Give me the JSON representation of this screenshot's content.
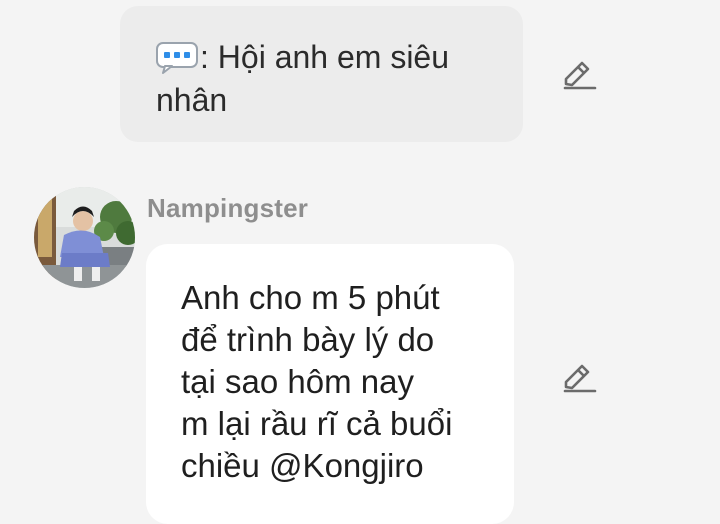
{
  "system_message": {
    "icon": "chat-bubble-dots-icon",
    "text": ": Hội anh em siêu nhân"
  },
  "message": {
    "sender": "Nampingster",
    "text": "Anh cho m  5 phút\nđể trình bày lý do\ntại sao hôm nay\nm lại rầu rĩ cả buổi\nchiều @Kongjiro"
  },
  "colors": {
    "background": "#f4f4f4",
    "system_bubble": "#ececec",
    "message_bubble": "#ffffff",
    "sender_name": "#8e8e8e",
    "icon_blue": "#2f8ee8"
  }
}
